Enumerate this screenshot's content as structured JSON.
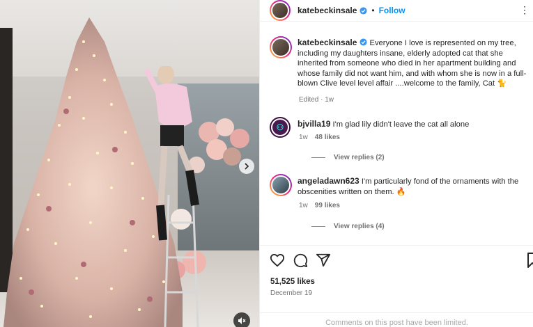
{
  "post": {
    "author": "katebeckinsale",
    "follow_label": "Follow",
    "dot": "•",
    "more": "⋮",
    "caption": "Everyone I love is represented on my tree, including my daughters insane, elderly adopted cat that she inherited from someone who died in her apartment building and whose family did not want him, and with whom she is now in a full-blown Clive level level affair ....welcome to the family, Cat 🐈",
    "caption_meta": "Edited · 1w",
    "likes": "51,525 likes",
    "date": "December 19",
    "comments_limited": "Comments on this post have been limited."
  },
  "comments": [
    {
      "user": "bjvilla19",
      "text": "I'm glad lily didn't leave the cat all alone",
      "age": "1w",
      "likes": "48 likes",
      "view_replies": "View replies (2)"
    },
    {
      "user": "angeladawn623",
      "text": "I'm particularly fond of the ornaments with the obscenities written on them. 🔥",
      "age": "1w",
      "likes": "99 likes",
      "view_replies": "View replies (4)"
    }
  ],
  "icons": {
    "like": "heart-icon",
    "comment": "comment-icon",
    "share": "share-icon",
    "save": "bookmark-icon",
    "next": "chevron-right-icon",
    "mute": "muted-speaker-icon",
    "verified": "verified-badge-icon"
  },
  "colors": {
    "follow": "#0095f6",
    "verified": "#3897f0",
    "secondary_text": "#737373",
    "limited_text": "#a8a8a8"
  }
}
